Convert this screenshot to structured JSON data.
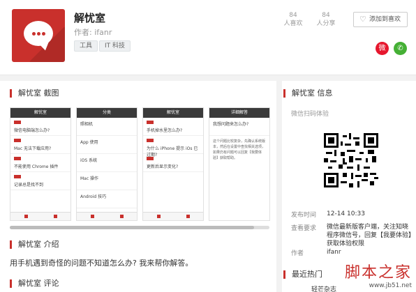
{
  "app": {
    "title": "解忧室",
    "author": "作者: ifanr",
    "tags": [
      "工具",
      "IT 科技"
    ],
    "stats": [
      {
        "num": "84",
        "label": "人喜欢"
      },
      {
        "num": "84",
        "label": "人分享"
      }
    ],
    "fav_button": "添加到喜欢",
    "icon_name": "chat-bubble-icon",
    "brand_color": "#c9302c"
  },
  "share": {
    "weibo": "weibo-icon",
    "wechat": "wechat-icon"
  },
  "sections": {
    "screenshots": "解忧室 截图",
    "intro": "解忧室 介绍",
    "review": "解忧室 评论",
    "info": "解忧室 信息",
    "hot": "最近热门"
  },
  "screenshots": [
    {
      "bar": "解忧室",
      "rows": [
        "微信电脑端怎么办?",
        "Mac 无法下载应用?",
        "不能使用 Chrome 插件",
        "记录总是找不到"
      ]
    },
    {
      "bar": "分类",
      "rows": [
        "照相机",
        "App 使用",
        "iOS 系统",
        "Mac 操作",
        "Android 技巧"
      ]
    },
    {
      "bar": "解忧室",
      "rows": [
        "手机掉水里怎么办?",
        "为什么 iPhone 提示 iOs 已过期?",
        "更新后显示变化?"
      ]
    },
    {
      "bar": "详细解答",
      "title": "我想问题来怎么办?",
      "para": "这个问题比较复杂，先确认系统版本，然后在设置中查找相关选项，如果仍有问题可以回复【我要体验】获取帮助。"
    }
  ],
  "intro": {
    "text": "用手机遇到奇怪的问题不知道怎么办? 我来帮你解答。"
  },
  "info": {
    "qr_label": "微信扫码体验",
    "publish_key": "发布时间",
    "publish_val": "12-14 10:33",
    "req_key": "查看要求",
    "req_val": "微信最新版客户端，关注知晓程序微信号，回复【我要体验】获取体验权限",
    "author_key": "作者",
    "author_val": "ifanr"
  },
  "hot": {
    "first_item": "轻芒杂志"
  },
  "watermark": {
    "title": "脚本之家",
    "url": "www.jb51.net"
  }
}
